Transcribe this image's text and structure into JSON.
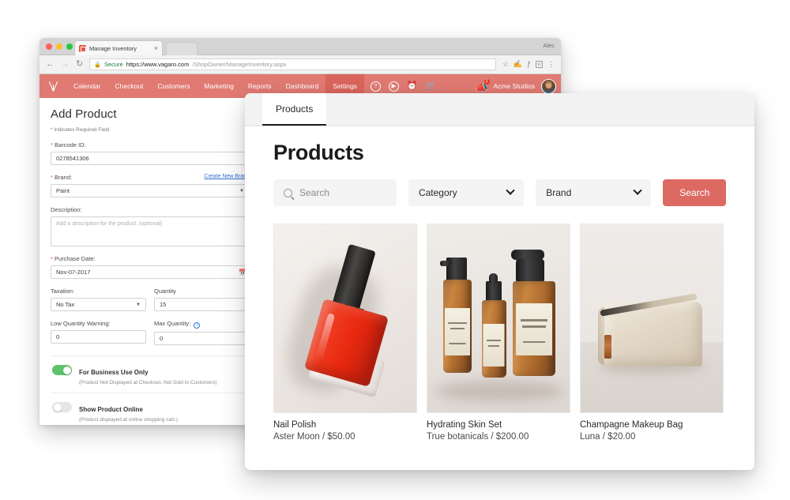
{
  "browser": {
    "tab_title": "Manage Inventory",
    "tab_close": "×",
    "back_icon": "←",
    "forward_icon": "→",
    "reload_icon": "↻",
    "lock_icon": "🔒",
    "secure_label": "Secure",
    "url_domain": "https://www.vagaro.com",
    "url_path": "/ShopOwner/ManageInventory.aspx",
    "star_icon": "☆",
    "chrome_user": "Alec",
    "menu_icon": "⋮"
  },
  "vagaro_nav": {
    "logo": "vagaro-logo",
    "items": [
      {
        "label": "Calendar",
        "active": false
      },
      {
        "label": "Checkout",
        "active": false
      },
      {
        "label": "Customers",
        "active": false
      },
      {
        "label": "Marketing",
        "active": false
      },
      {
        "label": "Reports",
        "active": false
      },
      {
        "label": "Dashboard",
        "active": false
      },
      {
        "label": "Settings",
        "active": true
      }
    ],
    "help_icon": "?",
    "play_icon": "▶",
    "clock_icon": "⏰",
    "cart_icon": "🛒",
    "bell_icon": "🔔",
    "notification_count": "1",
    "shop_name": "Acme Studios",
    "avatar": "user-avatar"
  },
  "form": {
    "title": "Add Product",
    "required_note": "Indicates Required Field",
    "required_star": "*",
    "barcode": {
      "label": "Barcode ID:",
      "value": "0278541306"
    },
    "brand": {
      "label": "Brand:",
      "value": "Paint",
      "link": "Create New Brand"
    },
    "description": {
      "label": "Description:",
      "placeholder": "Add a description for the product. (optional)"
    },
    "purchase_date": {
      "label": "Purchase Date:",
      "value": "Nov-07-2017",
      "icon": "📅"
    },
    "taxation": {
      "label": "Taxation:",
      "value": "No Tax"
    },
    "quantity": {
      "label": "Quantity",
      "value": "15"
    },
    "low_quantity": {
      "label": "Low Quantity Warning:",
      "value": "0"
    },
    "max_quantity": {
      "label": "Max Quantity:",
      "value": "0",
      "info_icon": "i"
    },
    "toggles": [
      {
        "title": "For Business Use Only",
        "subtitle": "(Product Not Displayed at Checkout, Not Sold to Customers)",
        "state": "on"
      },
      {
        "title": "Show Product Online",
        "subtitle": "(Product displayed at online shopping cart.)",
        "state": "off"
      }
    ]
  },
  "products_panel": {
    "tab_label": "Products",
    "title": "Products",
    "search": {
      "placeholder": "Search",
      "value": "",
      "icon": "search-icon"
    },
    "category_filter": {
      "label": "Category",
      "caret": "chevron-down-icon"
    },
    "brand_filter": {
      "label": "Brand",
      "caret": "chevron-down-icon"
    },
    "search_button": "Search",
    "products": [
      {
        "name": "Nail Polish",
        "meta": "Aster Moon / $50.00",
        "brand": "Aster Moon",
        "price": "$50.00",
        "image": "red-nail-polish-bottle"
      },
      {
        "name": "Hydrating Skin Set",
        "meta": "True botanicals / $200.00",
        "brand": "True botanicals",
        "price": "$200.00",
        "image": "amber-glass-bottle-set"
      },
      {
        "name": "Champagne Makeup Bag",
        "meta": "Luna / $20.00",
        "brand": "Luna",
        "price": "$20.00",
        "image": "cream-makeup-pouch"
      }
    ]
  },
  "colors": {
    "vagaro_nav": "#e07a72",
    "nav_active": "#d9655c",
    "search_button": "#dd6a62",
    "toggle_on": "#5ec26a",
    "link": "#2f6fd0",
    "required_star": "#e0564b"
  }
}
